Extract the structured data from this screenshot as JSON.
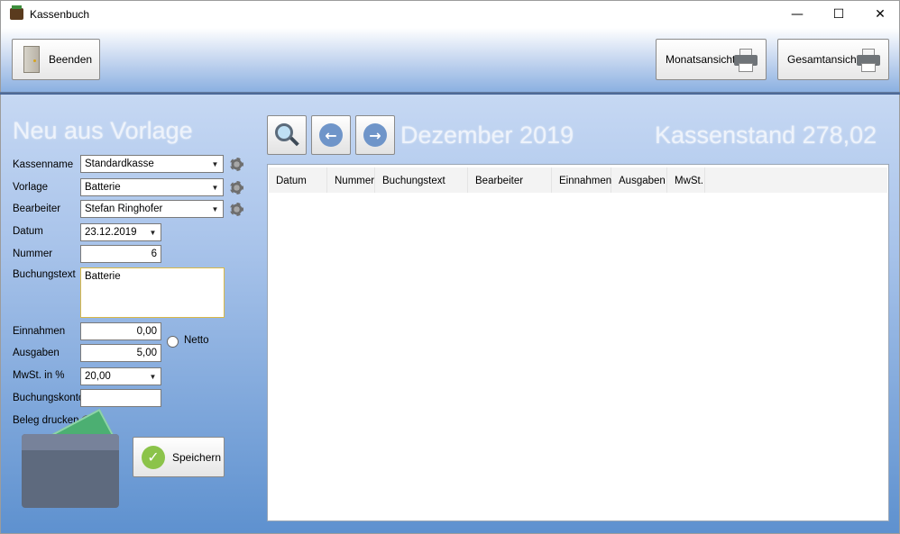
{
  "window": {
    "title": "Kassenbuch",
    "minimize": "—",
    "maximize": "☐",
    "close": "✕"
  },
  "toolbar": {
    "beenden": "Beenden",
    "monatsansicht": "Monatsansicht",
    "gesamtansicht": "Gesamtansicht"
  },
  "form": {
    "heading": "Neu aus Vorlage",
    "kassenname": {
      "label": "Kassenname",
      "value": "Standardkasse"
    },
    "vorlage": {
      "label": "Vorlage",
      "value": "Batterie"
    },
    "bearbeiter": {
      "label": "Bearbeiter",
      "value": "Stefan Ringhofer"
    },
    "datum": {
      "label": "Datum",
      "value": "23.12.2019"
    },
    "nummer": {
      "label": "Nummer",
      "value": "6"
    },
    "buchungstext": {
      "label": "Buchungstext",
      "value": "Batterie"
    },
    "einnahmen": {
      "label": "Einnahmen",
      "value": "0,00"
    },
    "netto": {
      "label": "Netto",
      "checked": false
    },
    "ausgaben": {
      "label": "Ausgaben",
      "value": "5,00"
    },
    "mwst": {
      "label": "MwSt. in %",
      "value": "20,00"
    },
    "buchungskonto": {
      "label": "Buchungskonto",
      "value": ""
    },
    "beleg": {
      "label": "Beleg drucken",
      "checked": false
    },
    "save": "Speichern"
  },
  "nav": {
    "month": "Dezember 2019",
    "kassenstand": "Kassenstand 278,02"
  },
  "table": {
    "columns": [
      "Datum",
      "Nummer",
      "Buchungstext",
      "Bearbeiter",
      "Einnahmen",
      "Ausgaben",
      "MwSt."
    ],
    "rows": []
  },
  "colors": {
    "accent": "#5e91cf",
    "toolbar": "#8bb0e1",
    "heading_text": "#eef3fb"
  },
  "icons": [
    "app-icon",
    "door-icon",
    "printer-icon",
    "gear-icon",
    "search-icon",
    "arrow-left-icon",
    "arrow-right-icon",
    "check-icon",
    "wallet-icon"
  ]
}
